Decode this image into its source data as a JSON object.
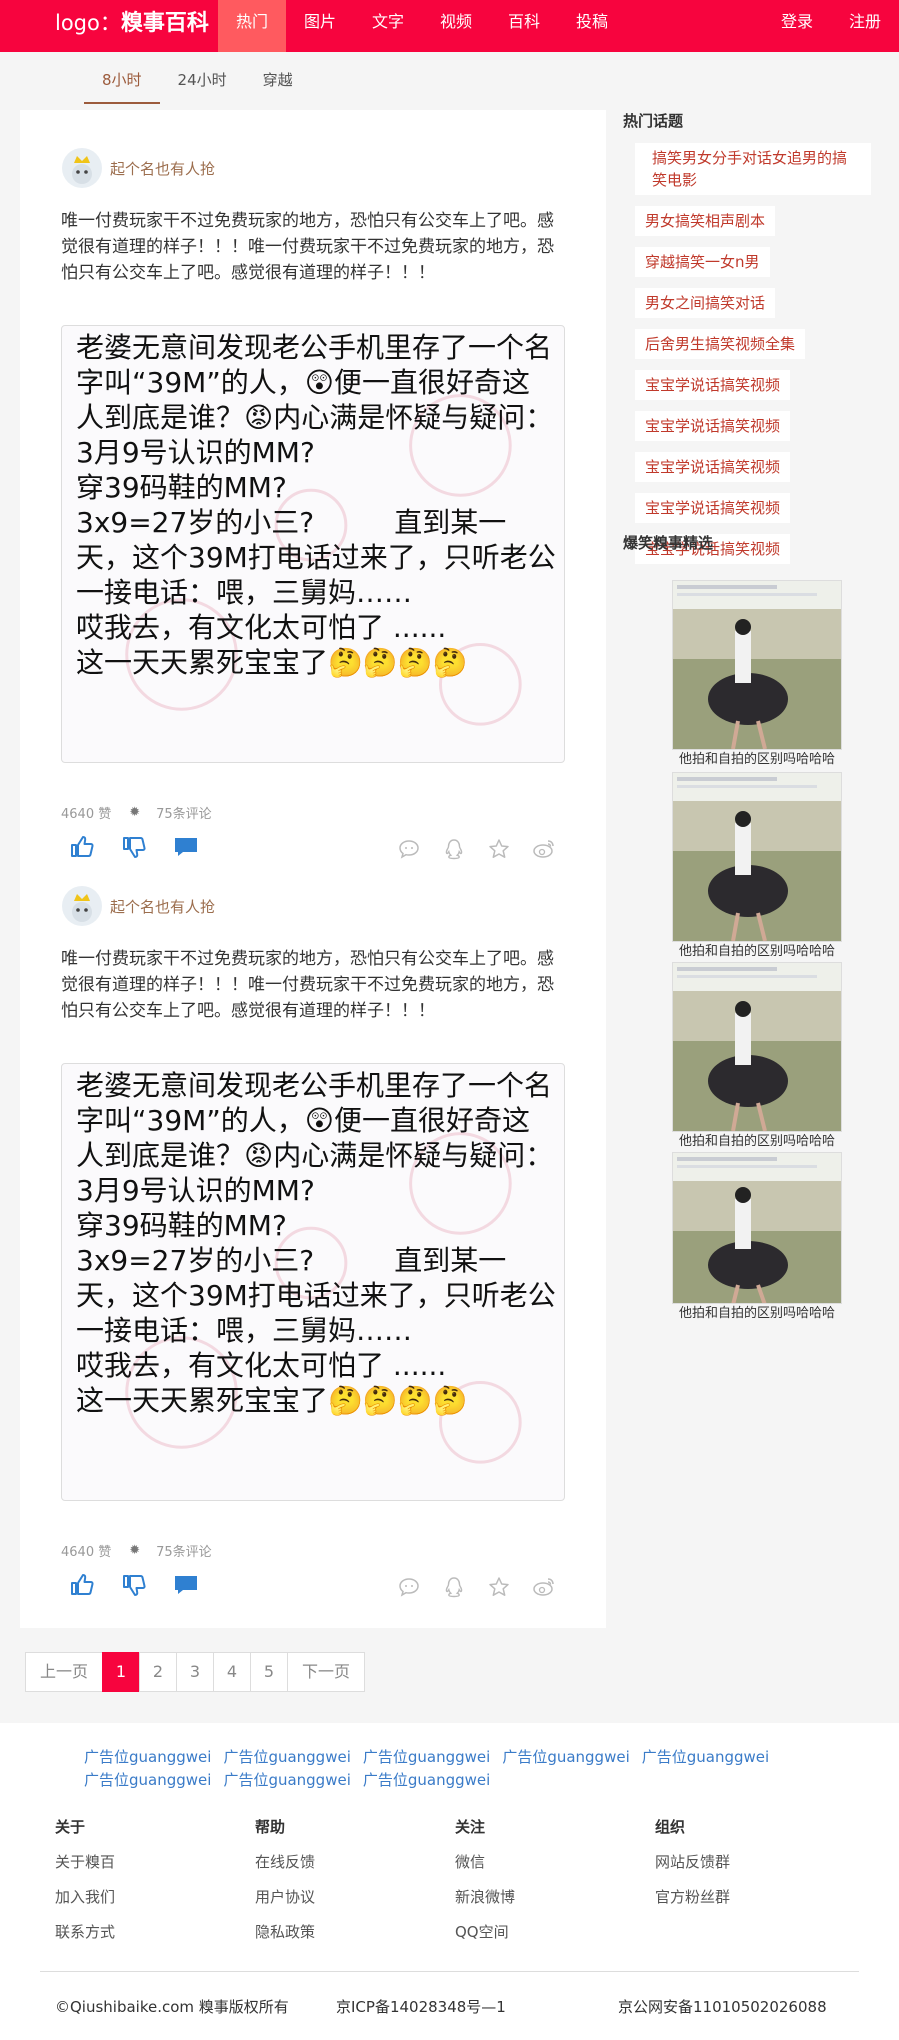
{
  "header": {
    "logo_prefix": "logo：",
    "logo_brand": "糗事百科",
    "nav": [
      "热门",
      "图片",
      "文字",
      "视频",
      "百科",
      "投稿"
    ],
    "login": "登录",
    "register": "注册"
  },
  "subnav": [
    "8小时",
    "24小时",
    "穿越"
  ],
  "posts": [
    {
      "author": "起个名也有人抢",
      "text": "唯一付费玩家干不过免费玩家的地方，恐怕只有公交车上了吧。感觉很有道理的样子！！！唯一付费玩家干不过免费玩家的地方，恐怕只有公交车上了吧。感觉很有道理的样子！！！",
      "image_text": "老婆无意间发现老公手机里存了一个名字叫“39M”的人，😲便一直很好奇这人到底是谁？😡内心满是怀疑与疑问：\n3月9号认识的MM?\n穿39码鞋的MM?\n3x9=27岁的小三?         直到某一天，这个39M打电话过来了，只听老公一接电话：喂，三舅妈……\n哎我去，有文化太可怕了 ......\n这一天天累死宝宝了🤔🤔🤔🤔",
      "likes": "4640 赞",
      "comments": "75条评论"
    },
    {
      "author": "起个名也有人抢",
      "text": "唯一付费玩家干不过免费玩家的地方，恐怕只有公交车上了吧。感觉很有道理的样子！！！唯一付费玩家干不过免费玩家的地方，恐怕只有公交车上了吧。感觉很有道理的样子！！！",
      "image_text": "老婆无意间发现老公手机里存了一个名字叫“39M”的人，😲便一直很好奇这人到底是谁？😡内心满是怀疑与疑问：\n3月9号认识的MM?\n穿39码鞋的MM?\n3x9=27岁的小三?         直到某一天，这个39M打电话过来了，只听老公一接电话：喂，三舅妈……\n哎我去，有文化太可怕了 ......\n这一天天累死宝宝了🤔🤔🤔🤔",
      "likes": "4640 赞",
      "comments": "75条评论"
    }
  ],
  "pagination": {
    "prev": "上一页",
    "pages": [
      "1",
      "2",
      "3",
      "4",
      "5"
    ],
    "next": "下一页"
  },
  "sidebar": {
    "hot_title": "热门话题",
    "topics": [
      "搞笑男女分手对话女追男的搞笑电影",
      "男女搞笑相声剧本",
      "穿越搞笑一女n男",
      "男女之间搞笑对话",
      "后舍男生搞笑视频全集",
      "宝宝学说话搞笑视频",
      "宝宝学说话搞笑视频",
      "宝宝学说话搞笑视频",
      "宝宝学说话搞笑视频",
      "宝宝学说话搞笑视频"
    ],
    "pics_title": "爆笑糗事精选",
    "pics": [
      {
        "caption": "他拍和自拍的区别吗哈哈哈"
      },
      {
        "caption": "他拍和自拍的区别吗哈哈哈"
      },
      {
        "caption": "他拍和自拍的区别吗哈哈哈"
      },
      {
        "caption": "他拍和自拍的区别吗哈哈哈"
      }
    ]
  },
  "footer": {
    "ads": [
      "广告位guanggwei",
      "广告位guanggwei",
      "广告位guanggwei",
      "广告位guanggwei",
      "广告位guanggwei",
      "广告位guanggwei",
      "广告位guanggwei",
      "广告位guanggwei"
    ],
    "columns": [
      {
        "title": "关于",
        "links": [
          "关于糗百",
          "加入我们",
          "联系方式"
        ]
      },
      {
        "title": "帮助",
        "links": [
          "在线反馈",
          "用户协议",
          "隐私政策"
        ]
      },
      {
        "title": "关注",
        "links": [
          "微信",
          "新浪微博",
          "QQ空间"
        ]
      },
      {
        "title": "组织",
        "links": [
          "网站反馈群",
          "官方粉丝群"
        ]
      }
    ],
    "copyright": "©Qiushibaike.com 糗事版权所有",
    "icp": "京ICP备14028348号—1",
    "police": "京公网安备11010502026088"
  },
  "colors": {
    "brand": "#f7043e",
    "nav_active": "#ff5a5f",
    "author": "#9c6e4e",
    "topic": "#c0392b",
    "ad_link": "#3a7bc8",
    "action_blue": "#2f80d1"
  }
}
